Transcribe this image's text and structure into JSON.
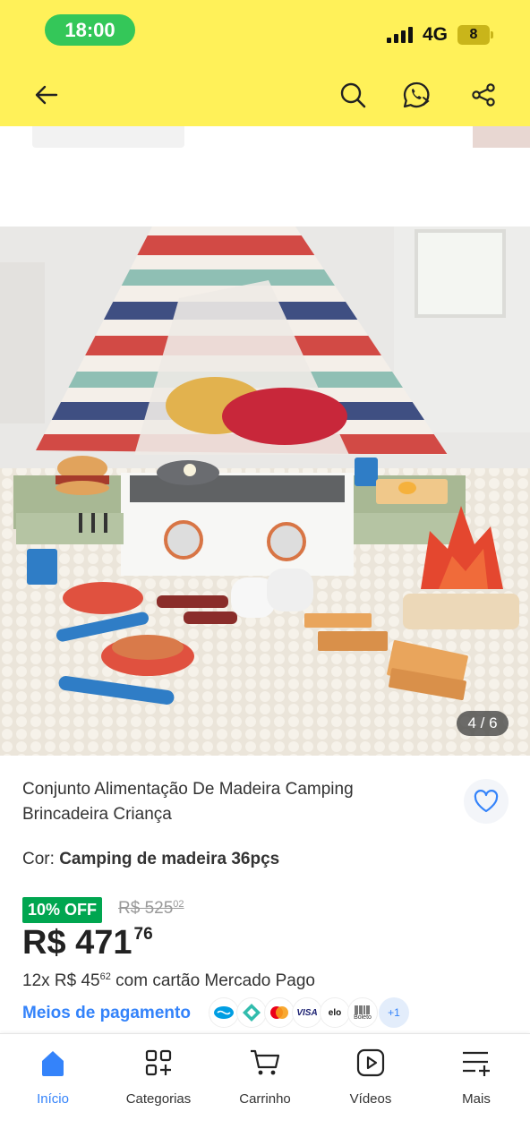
{
  "status_bar": {
    "time": "18:00",
    "network": "4G",
    "battery": "8"
  },
  "header": {
    "back_icon": "arrow-left-icon",
    "search_icon": "search-icon",
    "whatsapp_icon": "whatsapp-share-icon",
    "share_icon": "share-icon"
  },
  "gallery": {
    "counter": "4 / 6"
  },
  "product": {
    "title": "Conjunto Alimentação De Madeira Camping Brincadeira Criança",
    "color_label": "Cor:",
    "color_value": "Camping de madeira 36pçs",
    "discount": "10% OFF",
    "old_price_main": "R$ 525",
    "old_price_cents": "02",
    "price_main": "R$ 471",
    "price_cents": "76",
    "installments_prefix": "12x R$ 45",
    "installments_cents": "62",
    "installments_suffix": " com cartão Mercado Pago",
    "payment_link": "Meios de pagamento",
    "payment_icons": [
      "mercado-pago",
      "pix",
      "mastercard",
      "VISA",
      "elo",
      "Boleto"
    ],
    "payment_more": "+1"
  },
  "bottom_nav": {
    "items": [
      {
        "label": "Início",
        "icon": "home-icon",
        "active": true
      },
      {
        "label": "Categorias",
        "icon": "categories-icon"
      },
      {
        "label": "Carrinho",
        "icon": "cart-icon"
      },
      {
        "label": "Vídeos",
        "icon": "video-icon"
      },
      {
        "label": "Mais",
        "icon": "more-menu-icon"
      }
    ]
  },
  "colors": {
    "header_bg": "#fff159",
    "accent_blue": "#3483fa",
    "discount_green": "#00a650"
  }
}
